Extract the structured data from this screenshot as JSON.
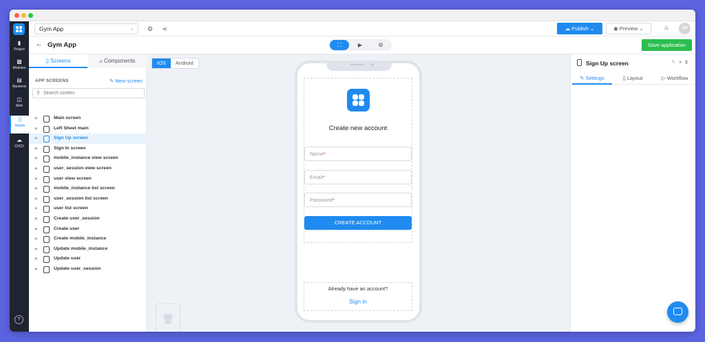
{
  "app": {
    "name": "Gym App",
    "page_title": "Gym App",
    "publish_label": "Publish",
    "preview_label": "Preview",
    "save_label": "Save application",
    "avatar_initials": "VP"
  },
  "leftnav": [
    {
      "label": "Project",
      "icon": "folder-icon"
    },
    {
      "label": "Modules",
      "icon": "modules-icon"
    },
    {
      "label": "Backend",
      "icon": "server-icon"
    },
    {
      "label": "Web",
      "icon": "web-icon"
    },
    {
      "label": "Mobile",
      "icon": "mobile-icon"
    },
    {
      "label": "CI/CD",
      "icon": "cloud-icon"
    }
  ],
  "panel": {
    "tabs": [
      "Screens",
      "Components"
    ],
    "section_title": "APP SCREENS",
    "new_screen": "New screen",
    "search_placeholder": "Search screen",
    "screens": [
      "Main screen",
      "Left Sheet main",
      "Sign Up screen",
      "Sign In screen",
      "mobile_instance view screen",
      "user_session view screen",
      "user view screen",
      "mobile_instance list screen",
      "user_session list screen",
      "user list screen",
      "Create user_session",
      "Create user",
      "Create mobile_instance",
      "Update mobile_instance",
      "Update user",
      "Update user_session"
    ],
    "selected_screen": "Sign Up screen"
  },
  "platform": {
    "ios": "IOS",
    "android": "Android",
    "selected": "IOS"
  },
  "form": {
    "title": "Create new account",
    "fields": [
      {
        "placeholder": "Name",
        "required_mark": "*"
      },
      {
        "placeholder": "Email",
        "required_mark": "*"
      },
      {
        "placeholder": "Password",
        "required_mark": "*"
      }
    ],
    "button": "CREATE ACCOUNT",
    "have_account": "Already have an account?",
    "signin": "Sign in"
  },
  "rightpanel": {
    "title": "Sign Up screen",
    "tabs": [
      "Settings",
      "Layout",
      "Workflow"
    ],
    "active_tab": "Settings"
  },
  "colors": {
    "accent": "#1f8bf0",
    "save": "#2cbe4e",
    "background": "#5b63e0"
  }
}
